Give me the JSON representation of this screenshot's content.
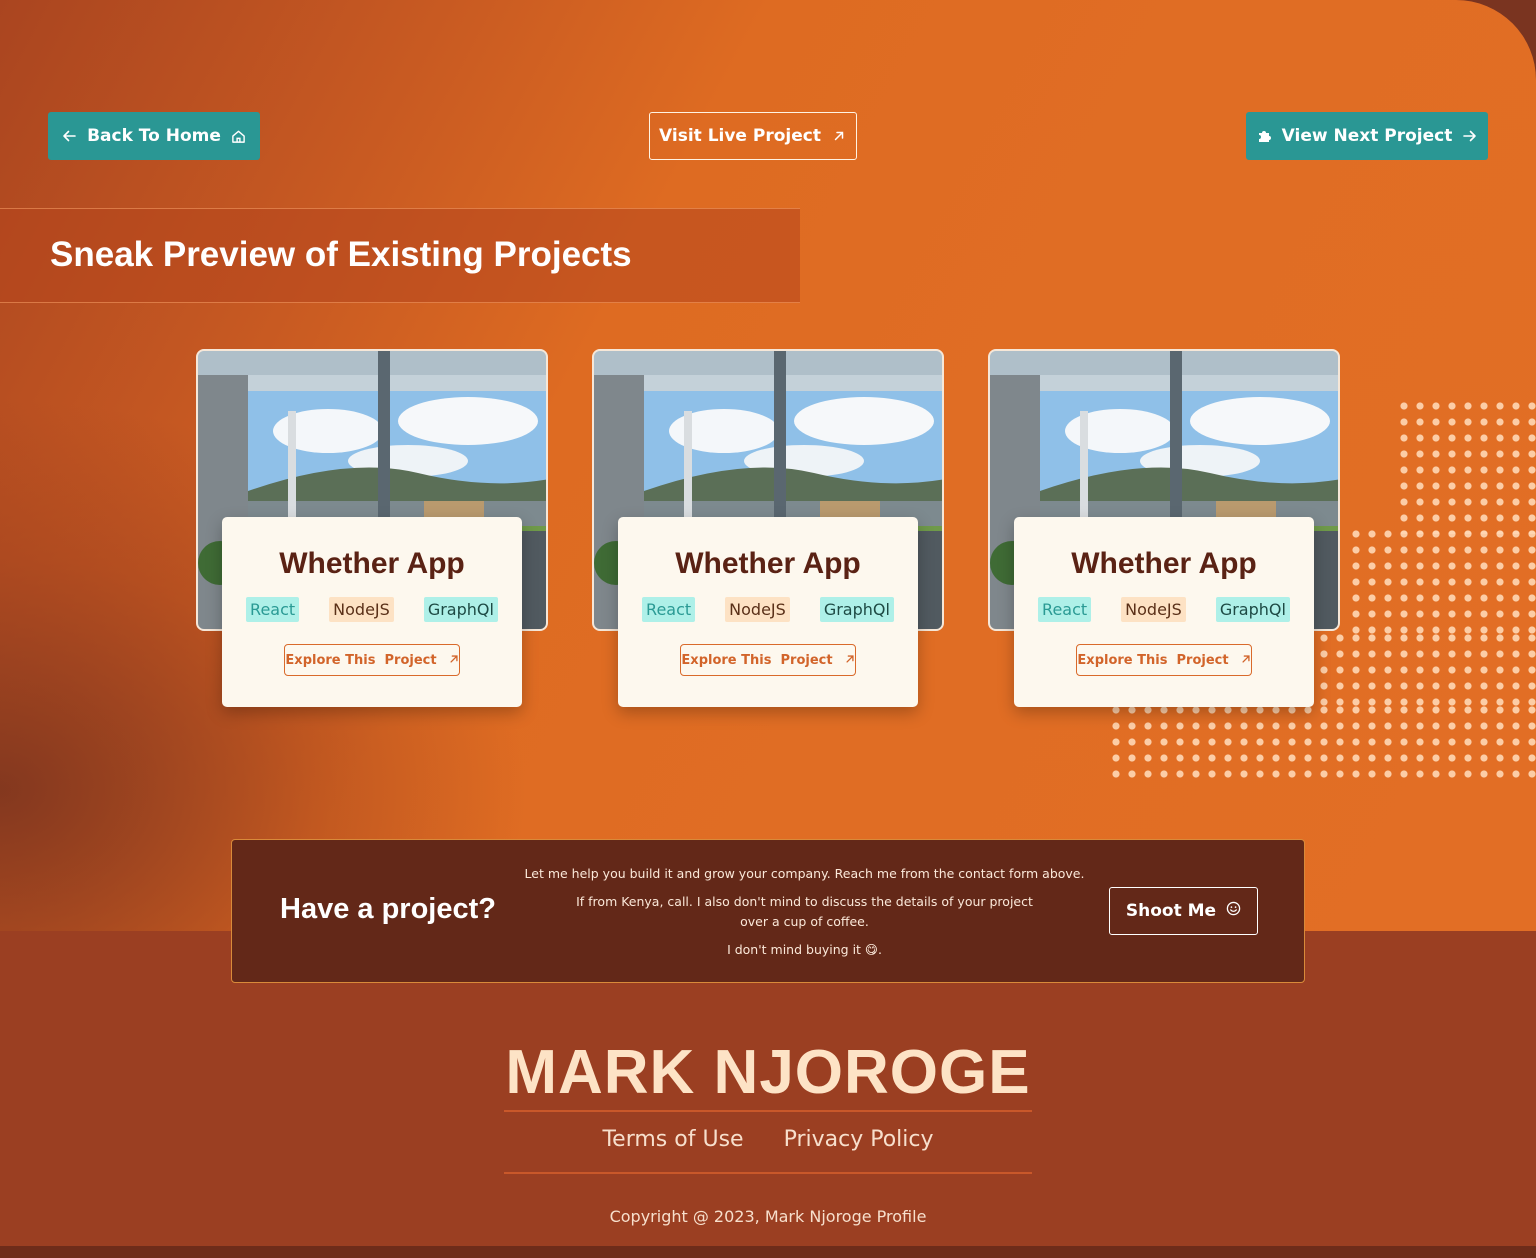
{
  "nav": {
    "back_label": "Back To Home",
    "visit_label": "Visit Live Project",
    "next_label": "View Next Project"
  },
  "section": {
    "title": "Sneak Preview of Existing Projects"
  },
  "cards": [
    {
      "title": "Whether App",
      "tags": [
        "React",
        "NodeJS",
        "GraphQl"
      ],
      "cta": "Explore This  Project"
    },
    {
      "title": "Whether App",
      "tags": [
        "React",
        "NodeJS",
        "GraphQl"
      ],
      "cta": "Explore This  Project"
    },
    {
      "title": "Whether App",
      "tags": [
        "React",
        "NodeJS",
        "GraphQl"
      ],
      "cta": "Explore This  Project"
    }
  ],
  "cta": {
    "title": "Have a project?",
    "line1": "Let me help you build it and grow your company. Reach me from the contact form above.",
    "line2": "If from Kenya, call. I also don't mind to discuss the details of your project over a cup of coffee.",
    "line3": "I don't mind buying it 😋.",
    "button": "Shoot Me"
  },
  "footer": {
    "brand": "MARK NJOROGE",
    "links": [
      "Terms of Use",
      "Privacy Policy"
    ],
    "copyright": "Copyright @ 2023, Mark Njoroge Profile"
  },
  "colors": {
    "accent_teal": "#2a9794",
    "hero_orange": "#e06d24",
    "card_title": "#5a2214",
    "cta_bg": "#632818",
    "footer_bg": "#9b3f22"
  }
}
